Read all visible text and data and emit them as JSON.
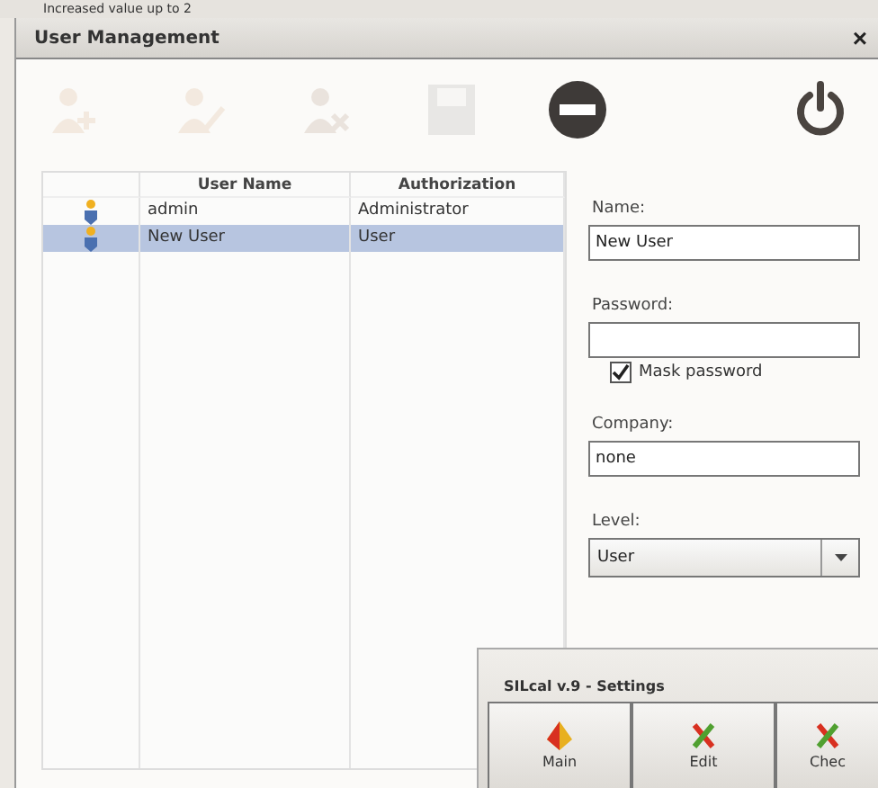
{
  "background": {
    "text": "Increased value up to 2"
  },
  "window": {
    "title": "User Management",
    "close": "×"
  },
  "toolbar": [
    {
      "kind": "add-user",
      "disabled": true
    },
    {
      "kind": "edit-user",
      "disabled": true
    },
    {
      "kind": "delete-user",
      "disabled": true
    },
    {
      "kind": "save",
      "disabled": true
    },
    {
      "kind": "no-entry",
      "disabled": false
    },
    {
      "kind": "power",
      "disabled": false
    }
  ],
  "table": {
    "columns": [
      "User Name",
      "Authorization"
    ],
    "rows": [
      {
        "name": "admin",
        "authorization": "Administrator",
        "selected": false
      },
      {
        "name": "New User",
        "authorization": "User",
        "selected": true
      }
    ]
  },
  "form": {
    "name_label": "Name:",
    "name_value": "New User",
    "password_label": "Password:",
    "mask_password": {
      "label": "Mask password",
      "checked": true
    },
    "company_label": "Company:",
    "company_value": "none",
    "level_label": "Level:",
    "level_value": "User"
  },
  "settings_window": {
    "title": "SILcal v.9 - Settings",
    "buttons": [
      {
        "label": "Main",
        "kind": "main"
      },
      {
        "label": "Edit",
        "kind": "tools"
      },
      {
        "label": "Chec",
        "kind": "tools"
      }
    ]
  }
}
